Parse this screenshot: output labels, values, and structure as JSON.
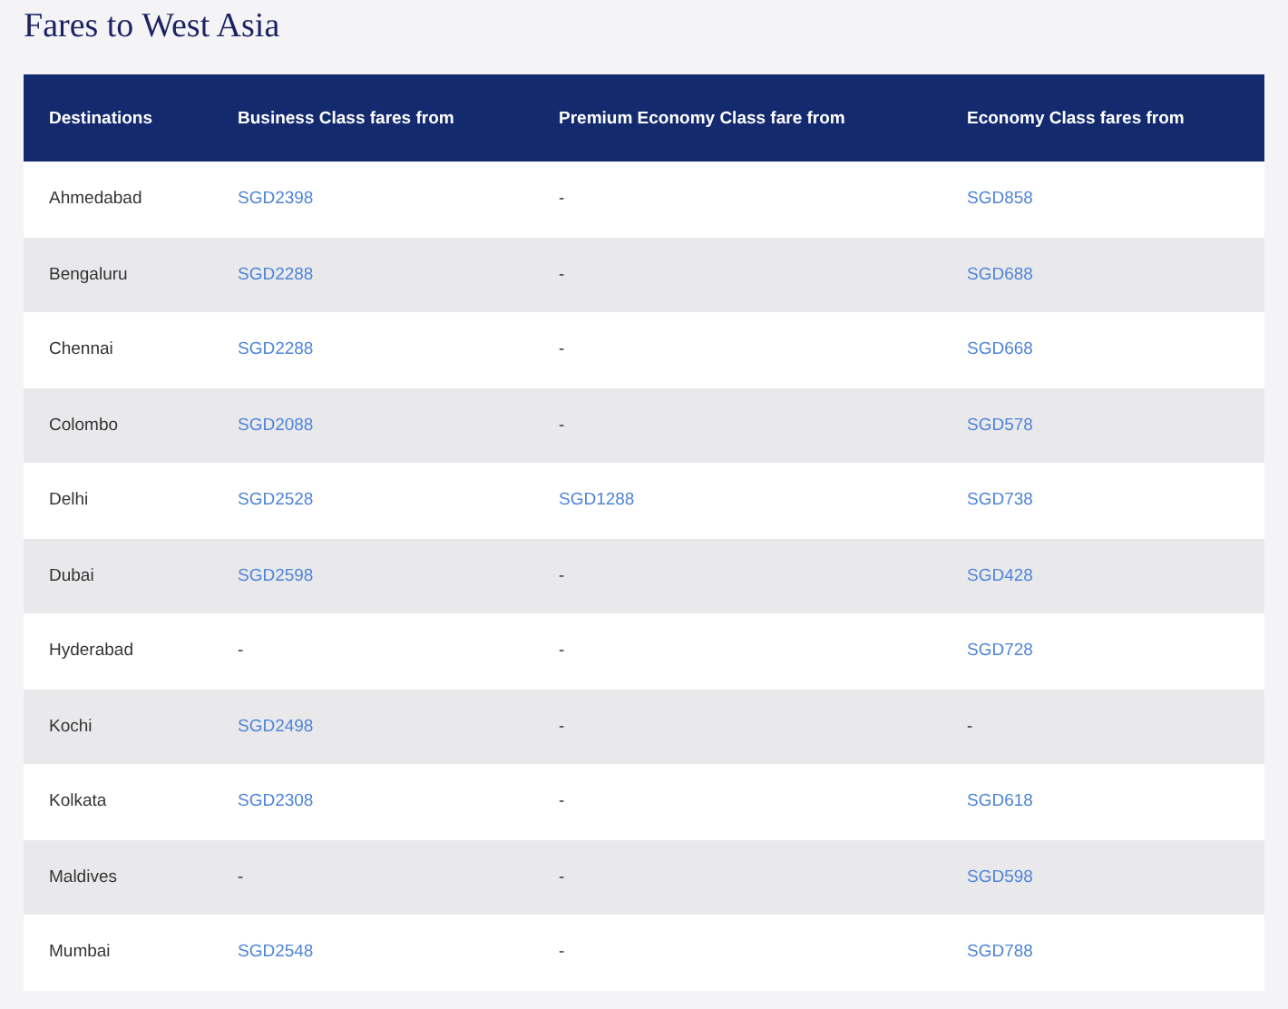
{
  "title": "Fares to West Asia",
  "table": {
    "columns": [
      "Destinations",
      "Business Class fares from",
      "Premium Economy Class fare from",
      "Economy Class fares from"
    ],
    "rows": [
      {
        "destination": "Ahmedabad",
        "fares": [
          {
            "text": "SGD2398",
            "kind": "link"
          },
          {
            "text": "-",
            "kind": "plain"
          },
          {
            "text": "SGD858",
            "kind": "link"
          }
        ]
      },
      {
        "destination": "Bengaluru",
        "fares": [
          {
            "text": "SGD2288",
            "kind": "link"
          },
          {
            "text": "-",
            "kind": "plain"
          },
          {
            "text": "SGD688",
            "kind": "link"
          }
        ]
      },
      {
        "destination": "Chennai",
        "fares": [
          {
            "text": "SGD2288",
            "kind": "link"
          },
          {
            "text": "-",
            "kind": "plain"
          },
          {
            "text": "SGD668",
            "kind": "link"
          }
        ]
      },
      {
        "destination": "Colombo",
        "fares": [
          {
            "text": "SGD2088",
            "kind": "link"
          },
          {
            "text": "-",
            "kind": "plain"
          },
          {
            "text": "SGD578",
            "kind": "link"
          }
        ]
      },
      {
        "destination": "Delhi",
        "fares": [
          {
            "text": "SGD2528",
            "kind": "link"
          },
          {
            "text": "SGD1288",
            "kind": "link"
          },
          {
            "text": "SGD738",
            "kind": "link"
          }
        ]
      },
      {
        "destination": "Dubai",
        "fares": [
          {
            "text": "SGD2598",
            "kind": "link"
          },
          {
            "text": "-",
            "kind": "plain"
          },
          {
            "text": "SGD428",
            "kind": "link"
          }
        ]
      },
      {
        "destination": "Hyderabad",
        "fares": [
          {
            "text": "-",
            "kind": "plain"
          },
          {
            "text": "-",
            "kind": "plain"
          },
          {
            "text": "SGD728",
            "kind": "link"
          }
        ]
      },
      {
        "destination": "Kochi",
        "fares": [
          {
            "text": "SGD2498",
            "kind": "link"
          },
          {
            "text": "-",
            "kind": "plain"
          },
          {
            "text": "-",
            "kind": "plain"
          }
        ]
      },
      {
        "destination": "Kolkata",
        "fares": [
          {
            "text": "SGD2308",
            "kind": "link"
          },
          {
            "text": "-",
            "kind": "plain"
          },
          {
            "text": "SGD618",
            "kind": "link"
          }
        ]
      },
      {
        "destination": "Maldives",
        "fares": [
          {
            "text": "-",
            "kind": "plain"
          },
          {
            "text": "-",
            "kind": "plain"
          },
          {
            "text": "SGD598",
            "kind": "link"
          }
        ]
      },
      {
        "destination": "Mumbai",
        "fares": [
          {
            "text": "SGD2548",
            "kind": "link"
          },
          {
            "text": "-",
            "kind": "plain"
          },
          {
            "text": "SGD788",
            "kind": "link"
          }
        ]
      }
    ]
  }
}
